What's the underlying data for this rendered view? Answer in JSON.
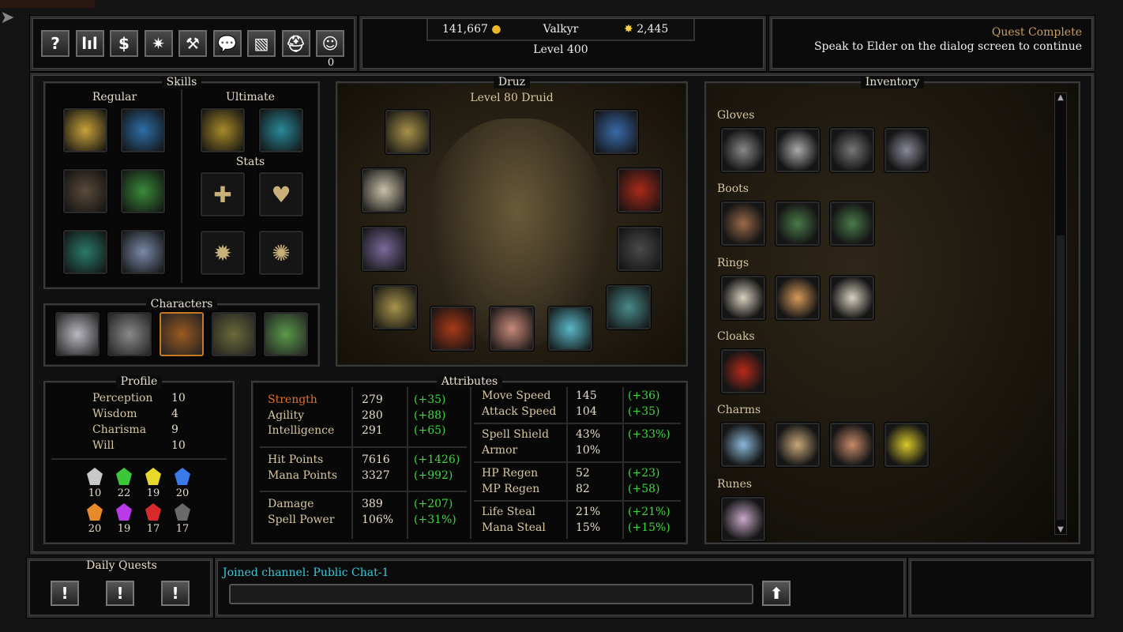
{
  "toolbar": {
    "buttons": [
      {
        "icon": "help-icon",
        "glyph": "?"
      },
      {
        "icon": "stats-icon",
        "glyph": "lıl"
      },
      {
        "icon": "shop-icon",
        "glyph": "$"
      },
      {
        "icon": "spark-icon",
        "glyph": "✷"
      },
      {
        "icon": "hammer-icon",
        "glyph": "⚒"
      },
      {
        "icon": "chat-icon",
        "glyph": "💬"
      },
      {
        "icon": "map-icon",
        "glyph": "▧"
      },
      {
        "icon": "helmet-icon",
        "glyph": "⛑"
      },
      {
        "icon": "party-icon",
        "glyph": "☺"
      }
    ],
    "party_count": "0"
  },
  "header": {
    "gold": "141,667",
    "player_name": "Valkyr",
    "stars": "2,445",
    "level": "Level 400"
  },
  "quest": {
    "title": "Quest Complete",
    "message": "Speak to Elder on the dialog screen to continue"
  },
  "skills": {
    "title": "Skills",
    "regular_label": "Regular",
    "ultimate_label": "Ultimate",
    "stats_label": "Stats",
    "regular": [
      {
        "name": "holy-burst",
        "color": "#c9a23a"
      },
      {
        "name": "lightning",
        "color": "#2e6fa8"
      },
      {
        "name": "shadow-hands",
        "color": "#5a4a3a"
      },
      {
        "name": "rainbow-orb",
        "color": "#3a8a3a"
      },
      {
        "name": "poison-dagger",
        "color": "#2a7a6a"
      },
      {
        "name": "frost-skull",
        "color": "#7a8aa8"
      }
    ],
    "ultimate": [
      {
        "name": "lightning-strike",
        "color": "#a88a2a"
      },
      {
        "name": "ice-blade",
        "color": "#2a8a9a"
      }
    ],
    "stats": [
      {
        "name": "plus-icon",
        "glyph": "✚"
      },
      {
        "name": "heart-icon",
        "glyph": "♥"
      },
      {
        "name": "star-burst-icon",
        "glyph": "✹"
      },
      {
        "name": "sun-icon",
        "glyph": "✺"
      }
    ]
  },
  "characters": {
    "title": "Characters",
    "portraits": [
      {
        "name": "valkyrie",
        "color": "#b8b8c0"
      },
      {
        "name": "hooded-mage",
        "color": "#8a8a8a"
      },
      {
        "name": "druid",
        "color": "#9a5a20",
        "selected": true
      },
      {
        "name": "treant",
        "color": "#6a6a3a"
      },
      {
        "name": "goblin",
        "color": "#5a9a4a"
      }
    ]
  },
  "character": {
    "name": "Druz",
    "subtitle": "Level 80 Druid",
    "equipment": [
      {
        "name": "amulet-slot",
        "color": "#a8924a"
      },
      {
        "name": "gem-necklace-slot",
        "color": "#3a6aa8"
      },
      {
        "name": "pouch-slot",
        "color": "#c8c0a8"
      },
      {
        "name": "cloak-slot",
        "color": "#a82a1a"
      },
      {
        "name": "skull-charm-slot",
        "color": "#7a6a9a"
      },
      {
        "name": "armor-slot",
        "color": "#4a4a4a"
      },
      {
        "name": "gauntlet-slot",
        "color": "#a8944a"
      },
      {
        "name": "rune-stone-slot",
        "color": "#a83a1a"
      },
      {
        "name": "boots-slot",
        "color": "#c88a7a"
      },
      {
        "name": "scroll-slot",
        "color": "#5ab8c8"
      },
      {
        "name": "ring-slot",
        "color": "#4a8a8a"
      }
    ]
  },
  "inventory": {
    "title": "Inventory",
    "categories": [
      {
        "label": "Gloves",
        "items": [
          "#888",
          "#aaa",
          "#777",
          "#8a8a9a"
        ]
      },
      {
        "label": "Boots",
        "items": [
          "#9a6a4a",
          "#4a7a4a",
          "#4a7a4a"
        ]
      },
      {
        "label": "Rings",
        "items": [
          "#d8d0c0",
          "#d89a5a",
          "#d8d0c0"
        ]
      },
      {
        "label": "Cloaks",
        "items": [
          "#b82a1a"
        ]
      },
      {
        "label": "Charms",
        "items": [
          "#8ab8d8",
          "#c8a87a",
          "#c88a6a",
          "#d8c82a"
        ]
      },
      {
        "label": "Runes",
        "items": [
          "#c8a8c8"
        ]
      }
    ]
  },
  "profile": {
    "title": "Profile",
    "traits": [
      {
        "label": "Perception",
        "value": "10"
      },
      {
        "label": "Wisdom",
        "value": "4"
      },
      {
        "label": "Charisma",
        "value": "9"
      },
      {
        "label": "Will",
        "value": "10"
      }
    ],
    "gems": [
      {
        "value": "10",
        "color": "#c8c8c8"
      },
      {
        "value": "22",
        "color": "#3ac83a"
      },
      {
        "value": "19",
        "color": "#e8d82a"
      },
      {
        "value": "20",
        "color": "#3a7ae8"
      },
      {
        "value": "20",
        "color": "#e88a2a"
      },
      {
        "value": "19",
        "color": "#b83ae8"
      },
      {
        "value": "17",
        "color": "#d82a2a"
      },
      {
        "value": "17",
        "color": "#6a6a6a"
      }
    ]
  },
  "attributes": {
    "title": "Attributes",
    "left": [
      [
        {
          "label": "Strength",
          "value": "279",
          "bonus": "(+35)",
          "highlight": true
        },
        {
          "label": "Agility",
          "value": "280",
          "bonus": "(+88)"
        },
        {
          "label": "Intelligence",
          "value": "291",
          "bonus": "(+65)"
        }
      ],
      [
        {
          "label": "Hit Points",
          "value": "7616",
          "bonus": "(+1426)"
        },
        {
          "label": "Mana Points",
          "value": "3327",
          "bonus": "(+992)"
        }
      ],
      [
        {
          "label": "Damage",
          "value": "389",
          "bonus": "(+207)"
        },
        {
          "label": "Spell Power",
          "value": "106%",
          "bonus": "(+31%)"
        }
      ]
    ],
    "right": [
      [
        {
          "label": "Move Speed",
          "value": "145",
          "bonus": "(+36)"
        },
        {
          "label": "Attack Speed",
          "value": "104",
          "bonus": "(+35)"
        }
      ],
      [
        {
          "label": "Spell Shield",
          "value": "43%",
          "bonus": "(+33%)"
        },
        {
          "label": "Armor",
          "value": "10%",
          "bonus": ""
        }
      ],
      [
        {
          "label": "HP Regen",
          "value": "52",
          "bonus": "(+23)"
        },
        {
          "label": "MP Regen",
          "value": "82",
          "bonus": "(+58)"
        }
      ],
      [
        {
          "label": "Life Steal",
          "value": "21%",
          "bonus": "(+21%)"
        },
        {
          "label": "Mana Steal",
          "value": "15%",
          "bonus": "(+15%)"
        }
      ]
    ]
  },
  "daily_quests": {
    "title": "Daily Quests",
    "buttons": [
      "!",
      "!",
      "!"
    ]
  },
  "chat": {
    "log": "Joined channel: Public Chat-1",
    "input_value": "",
    "send_icon": "arrow-up-icon"
  },
  "colors": {
    "gold": "#c8a060",
    "bonus": "#3ed83e",
    "strength": "#e07030",
    "chat": "#3ac8d8"
  }
}
